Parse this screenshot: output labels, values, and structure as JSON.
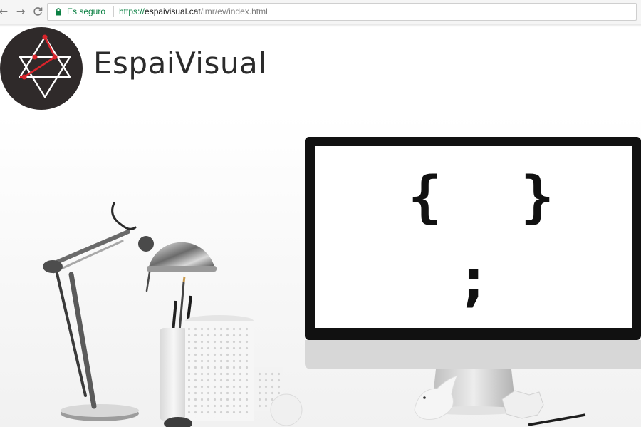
{
  "browser": {
    "back_glyph": "←",
    "forward_glyph": "→",
    "reload_glyph": "C",
    "secure_label": "Es seguro",
    "url_scheme": "https://",
    "url_host": "espaivisual.cat",
    "url_path": "/lmr/ev/index.html",
    "icons": [
      "back-arrow-icon",
      "forward-arrow-icon",
      "reload-icon",
      "lock-icon"
    ]
  },
  "site": {
    "brand_name": "EspaiVisual",
    "logo_icon": "star-of-david-network-icon",
    "colors": {
      "logo_bg": "#2f2a2a",
      "logo_accent": "#d9242b",
      "secure_green": "#0b8043"
    }
  },
  "hero": {
    "screen_open_brace": "{",
    "screen_close_brace": "}",
    "screen_semicolon": ";"
  }
}
